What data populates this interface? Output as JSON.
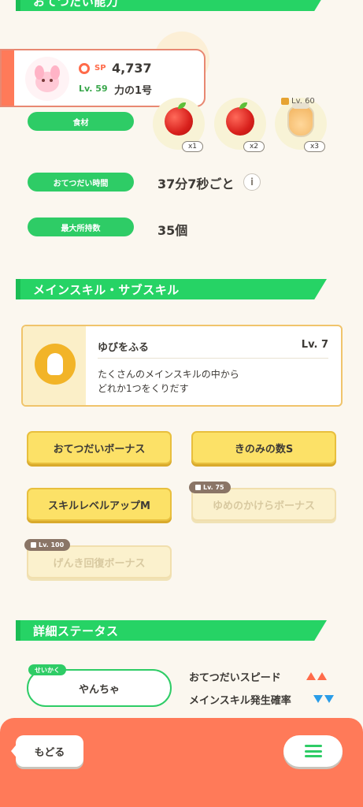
{
  "sections": {
    "ability_header": "おてつだい能力",
    "skill_header": "メインスキル・サブスキル",
    "detail_header": "詳細ステータス"
  },
  "profile": {
    "sp_label": "SP",
    "sp_value": "4,737",
    "level": "Lv. 59",
    "nickname": "力の1号"
  },
  "ability": {
    "ingredients_label": "食材",
    "ingredients": [
      {
        "name": "apple",
        "qty": "x1"
      },
      {
        "name": "apple",
        "qty": "x2"
      },
      {
        "name": "honey",
        "qty": "x3",
        "unlock": "Lv. 60"
      }
    ],
    "help_time_label": "おてつだい時間",
    "help_time_value": "37分7秒ごと",
    "capacity_label": "最大所持数",
    "capacity_value": "35個"
  },
  "main_skill": {
    "name": "ゆびをふる",
    "level": "Lv. 7",
    "desc_line1": "たくさんのメインスキルの中から",
    "desc_line2": "どれか1つをくりだす"
  },
  "sub_skills": [
    {
      "label": "おてつだいボーナス",
      "locked": false
    },
    {
      "label": "きのみの数S",
      "locked": false
    },
    {
      "label": "スキルレベルアップM",
      "locked": false
    },
    {
      "label": "ゆめのかけらボーナス",
      "locked": true,
      "unlock": "Lv. 75"
    },
    {
      "label": "げんき回復ボーナス",
      "locked": true,
      "unlock": "Lv. 100"
    }
  ],
  "nature": {
    "tag": "せいかく",
    "value": "やんちゃ",
    "effects": [
      {
        "label": "おてつだいスピード",
        "direction": "up"
      },
      {
        "label": "メインスキル発生確率",
        "direction": "down"
      }
    ]
  },
  "footer": {
    "back_label": "もどる"
  },
  "colors": {
    "accent_green": "#26d365",
    "accent_orange": "#ff7a59",
    "skill_yellow": "#fce167"
  }
}
